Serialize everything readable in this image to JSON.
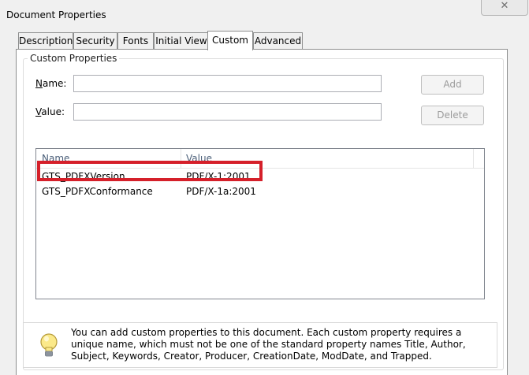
{
  "window": {
    "title": "Document Properties",
    "close_glyph": "✕"
  },
  "tabs": [
    {
      "label": "Description"
    },
    {
      "label": "Security"
    },
    {
      "label": "Fonts"
    },
    {
      "label": "Initial View"
    },
    {
      "label": "Custom"
    },
    {
      "label": "Advanced"
    }
  ],
  "active_tab": "Custom",
  "custom_properties": {
    "group_label": "Custom Properties",
    "name_label_accel": "N",
    "name_label_rest": "ame:",
    "value_label_accel": "V",
    "value_label_rest": "alue:",
    "name_value": "",
    "value_value": "",
    "add_label": "Add",
    "delete_label": "Delete"
  },
  "list": {
    "columns": [
      "Name",
      "Value"
    ],
    "rows": [
      {
        "name": "GTS_PDFXVersion",
        "value": "PDF/X-1:2001"
      },
      {
        "name": "GTS_PDFXConformance",
        "value": "PDF/X-1a:2001"
      }
    ],
    "highlight_color": "#d5202a"
  },
  "info": {
    "icon": "lightbulb-icon",
    "text": "You can add custom properties to this document. Each custom property requires a unique name, which must not be one of the standard property names Title, Author, Subject, Keywords, Creator, Producer, CreationDate, ModDate, and Trapped."
  }
}
